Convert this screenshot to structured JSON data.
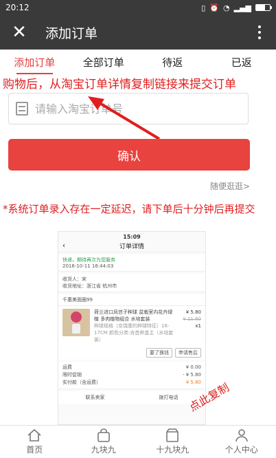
{
  "status_bar": {
    "time": "20:12",
    "icons": [
      "sim-icon",
      "alarm-icon",
      "wifi-icon",
      "signal-icon",
      "battery-icon"
    ]
  },
  "app_bar": {
    "title": "添加订单"
  },
  "tabs": [
    {
      "label": "添加订单",
      "active": true
    },
    {
      "label": "全部订单",
      "active": false
    },
    {
      "label": "待返",
      "active": false
    },
    {
      "label": "已返",
      "active": false
    }
  ],
  "annotation_top": "购物后，从淘宝订单详情复制链接来提交订单",
  "order_input": {
    "placeholder": "请输入淘宝订单号",
    "value": ""
  },
  "confirm_label": "确认",
  "browse_link": "随便逛逛>",
  "system_note": "*系统订单录入存在一定延迟，请下单后十分钟后再提交",
  "screenshot": {
    "time": "15:09",
    "title": "订单详情",
    "logistics": "快递，期待再次为您服务",
    "logistics_date": "2016-10-11 16:44:03",
    "receiver_label": "收货人：宋",
    "address_label": "收货地址：浙江省 杭州市",
    "shop": "千惠美面圈99",
    "product_name": "荷兰进口风信子种球 盆栽室内花卉绿植 多肉植物组合 水培套装",
    "product_spec": "种球规格（京瑞重的种球特征）16-17CM 颜色分类:含首养盒主（水培套装）",
    "price": "¥ 5.80",
    "orig_price": "¥ 11.60",
    "qty": "x1",
    "btn_return": "要了换钱",
    "btn_aftersale": "申请售后",
    "freight_label": "运费",
    "freight_value": "¥ 0.00",
    "promo_label": "限时促销",
    "promo_value": "- ¥ 5.80",
    "paid_label": "实付款（含运费）",
    "paid_value": "¥ 5.80",
    "contact_seller": "联系卖家",
    "call": "拨打电话"
  },
  "overlay_annotation": "点此复制",
  "bottom_nav": [
    {
      "label": "首页",
      "icon": "home-icon"
    },
    {
      "label": "九块九",
      "icon": "bag-icon"
    },
    {
      "label": "十九块九",
      "icon": "shop-icon"
    },
    {
      "label": "个人中心",
      "icon": "user-icon"
    }
  ],
  "colors": {
    "accent": "#e8433f",
    "annotation": "#e01e1e",
    "appbar": "#3a3a3a"
  }
}
